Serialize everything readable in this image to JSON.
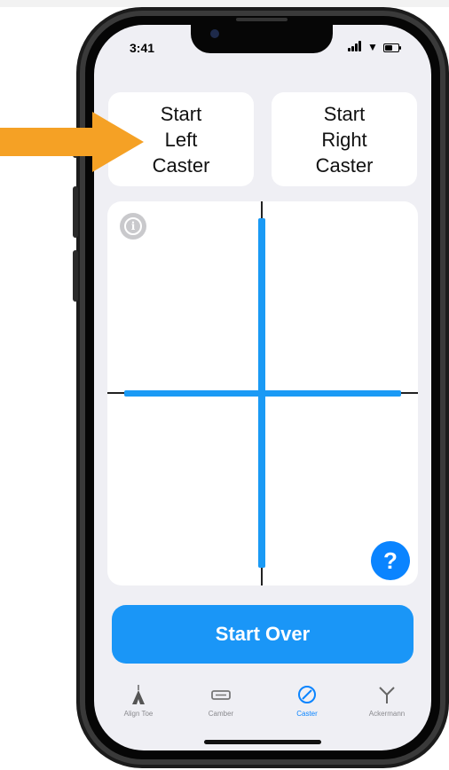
{
  "status_bar": {
    "time": "3:41"
  },
  "caster_buttons": {
    "left": {
      "line1": "Start",
      "line2": "Left",
      "line3": "Caster"
    },
    "right": {
      "line1": "Start",
      "line2": "Right",
      "line3": "Caster"
    }
  },
  "panel": {
    "info_glyph": "i",
    "help_glyph": "?"
  },
  "start_over_label": "Start Over",
  "tabs": [
    {
      "label": "Align Toe",
      "icon": "align-toe-icon",
      "active": false
    },
    {
      "label": "Camber",
      "icon": "camber-icon",
      "active": false
    },
    {
      "label": "Caster",
      "icon": "caster-icon",
      "active": true
    },
    {
      "label": "Ackermann",
      "icon": "ackermann-icon",
      "active": false
    }
  ],
  "colors": {
    "accent_blue": "#1a96f7",
    "crosshair_blue": "#1a9af5",
    "arrow_orange": "#f5a125",
    "screen_bg": "#efeff4"
  }
}
